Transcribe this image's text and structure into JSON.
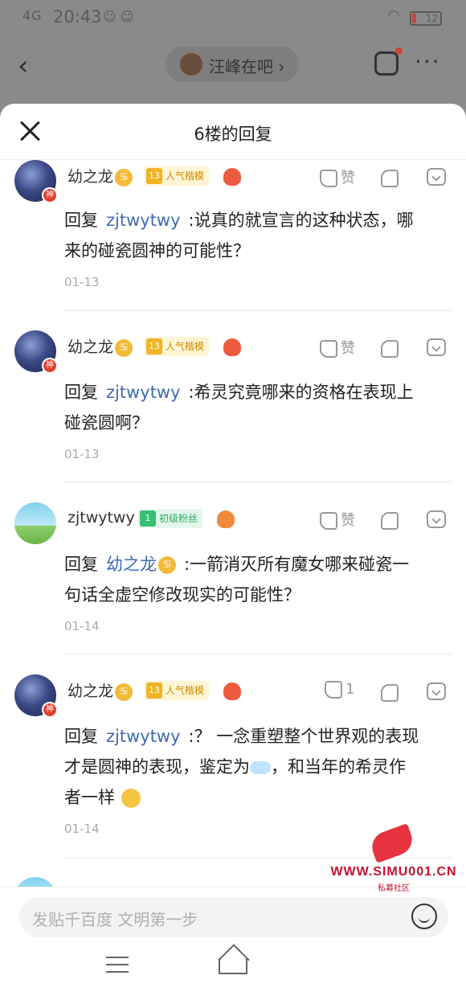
{
  "statusbar": {
    "signal": "4G",
    "time": "20:43",
    "apps": "☺ ☺",
    "wifi": "◠",
    "battery": "12"
  },
  "background": {
    "back_glyph": "‹",
    "forum_name": "汪峰在吧 ›",
    "more_glyph": "···"
  },
  "sheet": {
    "title": "6楼的回复"
  },
  "replies": [
    {
      "user": "幼之龙",
      "zodiac": "♋",
      "level": "13",
      "level_label": "人气楷模",
      "avatar": "night",
      "like_label": "赞",
      "reply_prefix": "回复",
      "mention": "zjtwytwy",
      "text_line1": ":说真的就宣言的这种状态，哪",
      "text_line2": "来的碰瓷圆神的可能性？",
      "date": "01-13"
    },
    {
      "user": "幼之龙",
      "zodiac": "♋",
      "level": "13",
      "level_label": "人气楷模",
      "avatar": "night",
      "like_label": "赞",
      "reply_prefix": "回复",
      "mention": "zjtwytwy",
      "text_line1": ":希灵究竟哪来的资格在表现上",
      "text_line2": "碰瓷圆啊？",
      "date": "01-13"
    },
    {
      "user": "zjtwytwy",
      "level": "1",
      "level_label": "初级粉丝",
      "avatar": "sky",
      "like_label": "赞",
      "reply_prefix": "回复",
      "mention": "幼之龙",
      "text_line1": ":一箭消灭所有魔女哪来碰瓷一",
      "text_line2": "句话全虚空修改现实的可能性？",
      "date": "01-14"
    },
    {
      "user": "幼之龙",
      "zodiac": "♋",
      "level": "13",
      "level_label": "人气楷模",
      "avatar": "night",
      "like_label": "1",
      "reply_prefix": "回复",
      "mention": "zjtwytwy",
      "text_line1": ":？ 一念重塑整个世界观的表现",
      "text_line2": "才是圆神的表现，鉴定为",
      "text_line2b": "，和当年的希灵作",
      "text_line3": "者一样",
      "date": "01-14"
    }
  ],
  "input": {
    "placeholder": "发贴千百度 文明第一步"
  },
  "watermark": {
    "site": "WWW.SIMU001.CN",
    "sub": "私募社区"
  },
  "colors": {
    "mention": "#3f6bb4",
    "level_gold": "#f0b423",
    "level_green": "#35c071"
  }
}
